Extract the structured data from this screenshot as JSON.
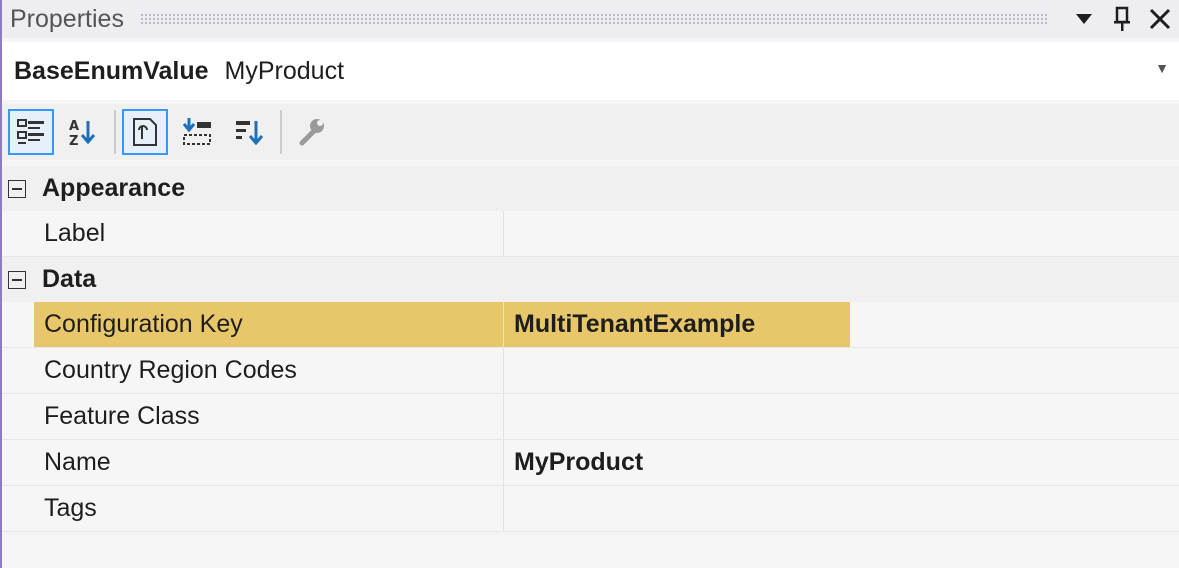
{
  "window": {
    "title": "Properties",
    "buttons": [
      "▼",
      "📌",
      "✕"
    ]
  },
  "selector": {
    "type": "BaseEnumValue",
    "name": "MyProduct"
  },
  "toolbar": {
    "tools": [
      "categorized",
      "alphabetical",
      "properties",
      "events",
      "property-pages",
      "settings"
    ]
  },
  "grid": {
    "categories": [
      {
        "label": "Appearance",
        "rows": [
          {
            "name": "Label",
            "value": ""
          }
        ]
      },
      {
        "label": "Data",
        "rows": [
          {
            "name": "Configuration Key",
            "value": "MultiTenantExample"
          },
          {
            "name": "Country Region Codes",
            "value": ""
          },
          {
            "name": "Feature Class",
            "value": ""
          },
          {
            "name": "Name",
            "value": "MyProduct"
          },
          {
            "name": "Tags",
            "value": ""
          }
        ]
      }
    ]
  },
  "colors": {
    "selection": "#e8c66a",
    "accent": "#3399ff",
    "border": "#8e7cc3"
  }
}
